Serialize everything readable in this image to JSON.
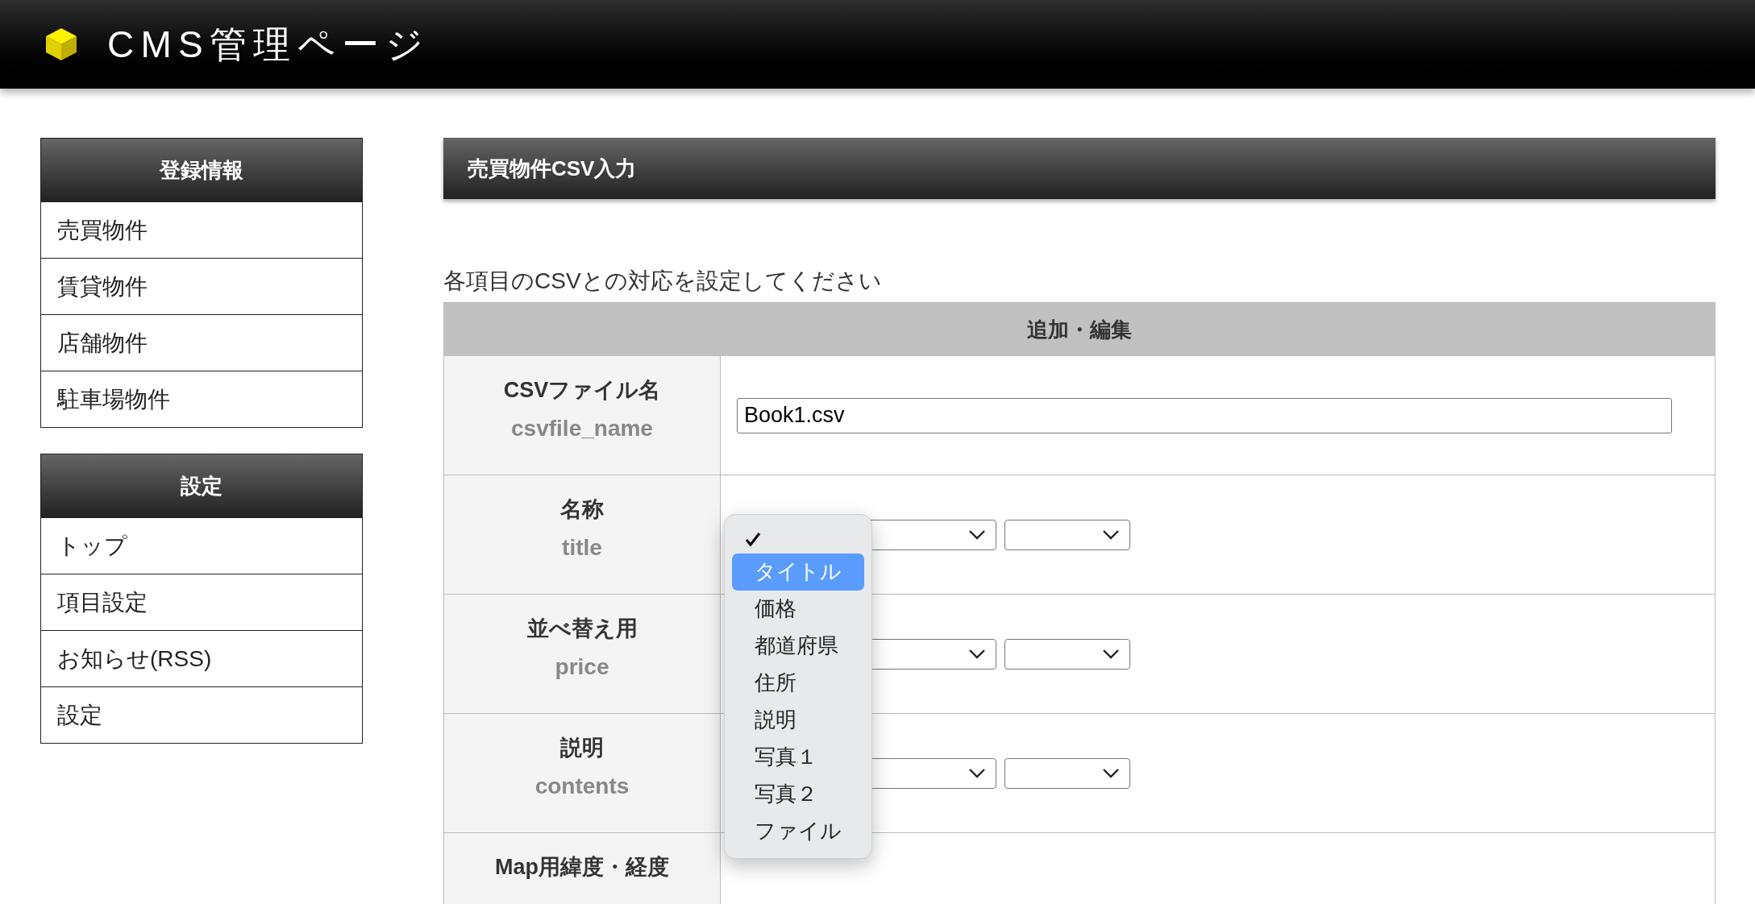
{
  "header": {
    "title": "CMS管理ページ"
  },
  "sidebar": [
    {
      "heading": "登録情報",
      "items": [
        "売買物件",
        "賃貸物件",
        "店舗物件",
        "駐車場物件"
      ]
    },
    {
      "heading": "設定",
      "items": [
        "トップ",
        "項目設定",
        "お知らせ(RSS)",
        "設定"
      ]
    }
  ],
  "page_title": "売買物件CSV入力",
  "instruction": "各項目のCSVとの対応を設定してください",
  "table": {
    "heading": "追加・編集",
    "rows": [
      {
        "label": "CSVファイル名",
        "key": "csvfile_name",
        "kind": "text",
        "value": "Book1.csv"
      },
      {
        "label": "名称",
        "key": "title",
        "kind": "select",
        "selects": [
          {
            "open": true
          },
          {
            "open": false
          }
        ]
      },
      {
        "label": "並べ替え用",
        "key": "price",
        "kind": "select",
        "selects": [
          {
            "open": false
          },
          {
            "open": false
          }
        ]
      },
      {
        "label": "説明",
        "key": "contents",
        "kind": "select",
        "selects": [
          {
            "open": false
          },
          {
            "open": false
          }
        ]
      },
      {
        "label": "Map用緯度・経度",
        "kind": "hidden"
      }
    ]
  },
  "dropdown": {
    "blank_option_checked": true,
    "options": [
      {
        "label": "タイトル",
        "highlighted": true
      },
      {
        "label": "価格",
        "highlighted": false
      },
      {
        "label": "都道府県",
        "highlighted": false
      },
      {
        "label": "住所",
        "highlighted": false
      },
      {
        "label": "説明",
        "highlighted": false
      },
      {
        "label": "写真１",
        "highlighted": false
      },
      {
        "label": "写真２",
        "highlighted": false
      },
      {
        "label": "ファイル",
        "highlighted": false
      }
    ]
  }
}
